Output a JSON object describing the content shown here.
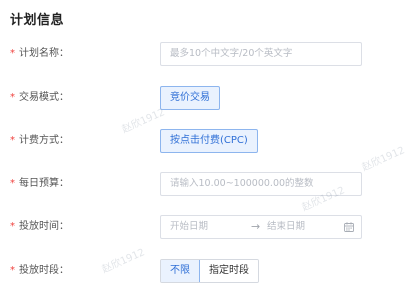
{
  "section": {
    "title": "计划信息"
  },
  "required_mark": "*",
  "form": {
    "plan_name": {
      "label": "计划名称：",
      "placeholder": "最多10个中文字/20个英文字"
    },
    "trade_mode": {
      "label": "交易模式：",
      "value": "竞价交易"
    },
    "billing": {
      "label": "计费方式：",
      "value": "按点击付费(CPC)"
    },
    "daily_budget": {
      "label": "每日预算：",
      "placeholder": "请输入10.00~100000.00的整数"
    },
    "schedule_date": {
      "label": "投放时间：",
      "start_placeholder": "开始日期",
      "separator": "→",
      "end_placeholder": "结束日期",
      "icon": "calendar-icon"
    },
    "schedule_period": {
      "label": "投放时段：",
      "options": [
        "不限",
        "指定时段"
      ],
      "selected": "不限"
    }
  },
  "watermarks": [
    "赵欣1912",
    "赵欣1912",
    "赵欣1912",
    "赵欣1912"
  ],
  "colors": {
    "accent": "#2f6fd6",
    "accent_bg": "#eaf2fe",
    "required": "#f0433f",
    "border": "#dcdfe6",
    "placeholder": "#b8bcc4"
  }
}
